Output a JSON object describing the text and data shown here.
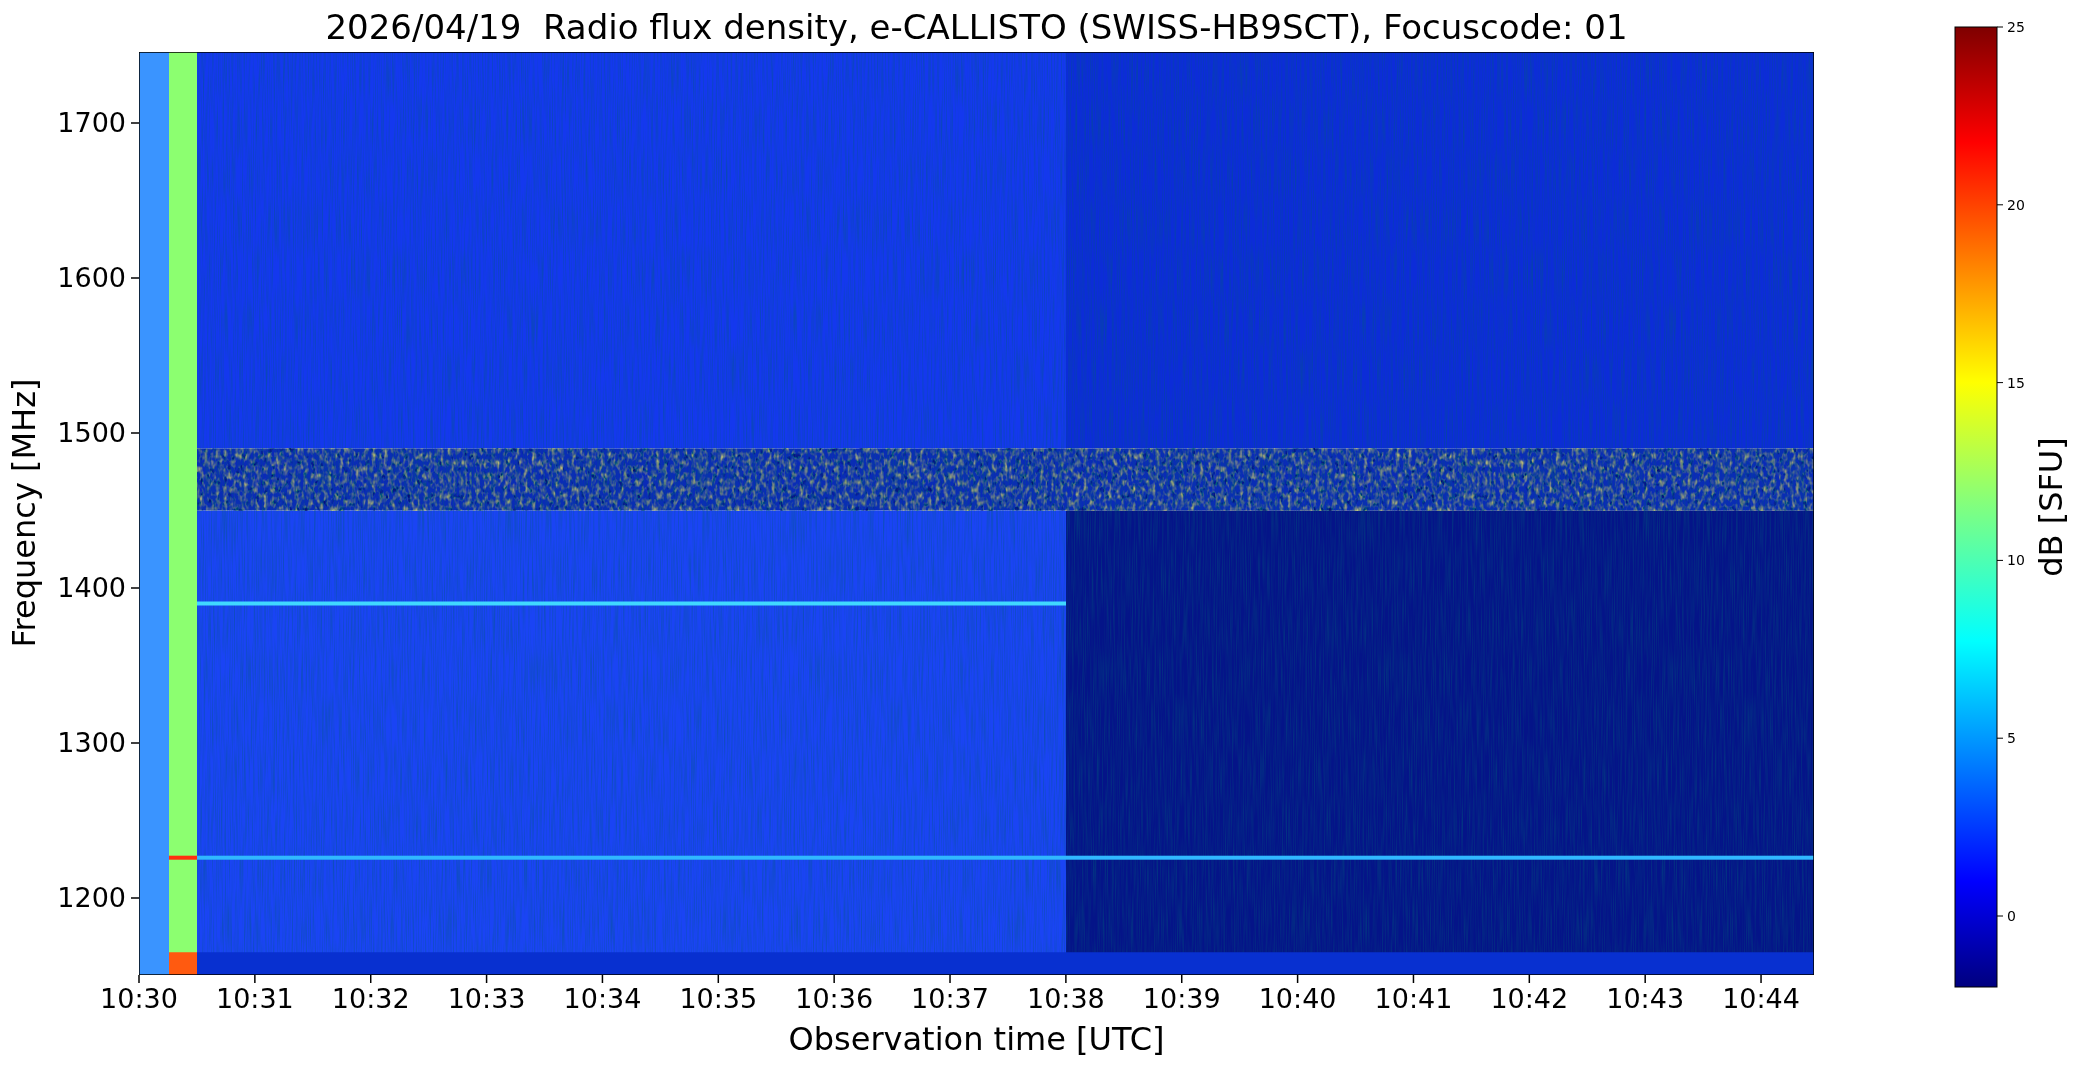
{
  "title": "2026/04/19  Radio flux density, e-CALLISTO (SWISS-HB9SCT), Focuscode: 01",
  "ylabel": "Frequency [MHz]",
  "xlabel": "Observation time [UTC]",
  "yticks": [
    "1700",
    "1600",
    "1500",
    "1400",
    "1300",
    "1200"
  ],
  "xticks": [
    "10:30",
    "10:31",
    "10:32",
    "10:33",
    "10:34",
    "10:35",
    "10:36",
    "10:37",
    "10:38",
    "10:39",
    "10:40",
    "10:41",
    "10:42",
    "10:43",
    "10:44"
  ],
  "colorbar": {
    "label": "dB [SFU]",
    "ticks": [
      "25",
      "20",
      "15",
      "10",
      "5",
      "0"
    ]
  }
}
